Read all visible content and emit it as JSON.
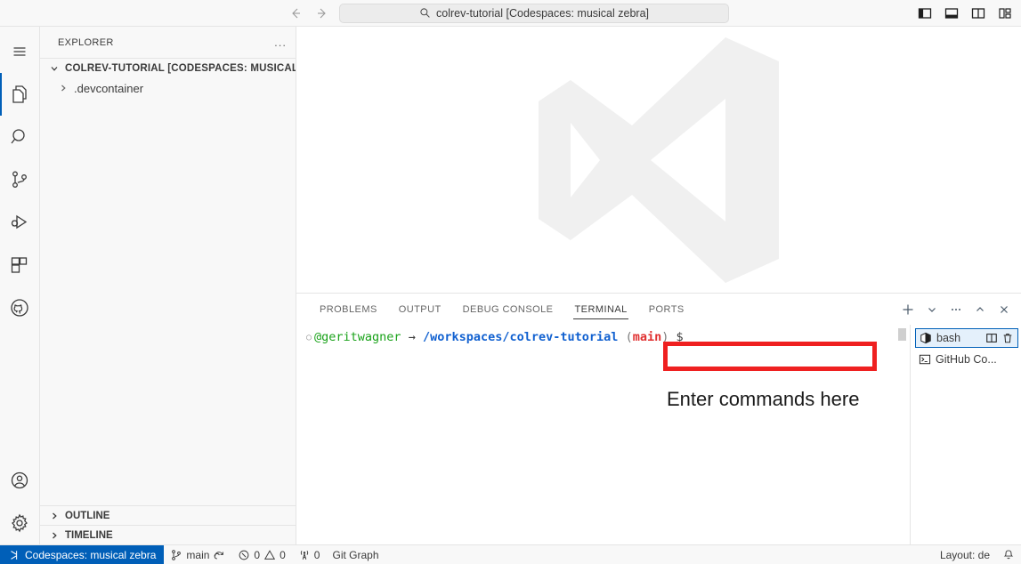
{
  "titlebar": {
    "back_label": "←",
    "forward_label": "→",
    "command_center_text": "colrev-tutorial [Codespaces: musical zebra]",
    "search_icon": "search-icon",
    "layout_icons": [
      {
        "name": "toggle-primary-sidebar-icon"
      },
      {
        "name": "toggle-panel-icon"
      },
      {
        "name": "toggle-secondary-sidebar-icon"
      },
      {
        "name": "customize-layout-icon"
      }
    ]
  },
  "activitybar": {
    "items": [
      {
        "name": "menu-icon",
        "label": "Menu",
        "active": false
      },
      {
        "name": "explorer-icon",
        "label": "Explorer",
        "active": true
      },
      {
        "name": "search-icon",
        "label": "Search",
        "active": false
      },
      {
        "name": "source-control-icon",
        "label": "Source Control",
        "active": false
      },
      {
        "name": "run-and-debug-icon",
        "label": "Run and Debug",
        "active": false
      },
      {
        "name": "extensions-icon",
        "label": "Extensions",
        "active": false
      },
      {
        "name": "github-icon",
        "label": "GitHub",
        "active": false
      }
    ],
    "bottom_items": [
      {
        "name": "accounts-icon",
        "label": "Accounts"
      },
      {
        "name": "settings-gear-icon",
        "label": "Manage"
      }
    ]
  },
  "sidebar": {
    "title": "EXPLORER",
    "more_actions": "...",
    "root_folder": "COLREV-TUTORIAL [CODESPACES: MUSICAL ZEB...",
    "children": [
      {
        "label": ".devcontainer",
        "expanded": false
      }
    ],
    "sections": [
      {
        "label": "OUTLINE",
        "expanded": false
      },
      {
        "label": "TIMELINE",
        "expanded": false
      }
    ]
  },
  "editor": {
    "watermark": "vscode-logo-watermark"
  },
  "panel": {
    "tabs": [
      {
        "label": "PROBLEMS",
        "active": false
      },
      {
        "label": "OUTPUT",
        "active": false
      },
      {
        "label": "DEBUG CONSOLE",
        "active": false
      },
      {
        "label": "TERMINAL",
        "active": true
      },
      {
        "label": "PORTS",
        "active": false
      }
    ],
    "actions": [
      {
        "name": "new-terminal-icon",
        "label": "+"
      },
      {
        "name": "chevron-down-icon",
        "label": "⌄"
      },
      {
        "name": "more-actions-icon",
        "label": "…"
      },
      {
        "name": "collapse-panel-icon",
        "label": "^"
      },
      {
        "name": "close-panel-icon",
        "label": "×"
      }
    ],
    "terminal": {
      "prompt_bullet": "○",
      "user": "@geritwagner",
      "arrow": "→",
      "path": "/workspaces/colrev-tutorial",
      "paren_open": "(",
      "branch": "main",
      "paren_close": ")",
      "dollar": "$",
      "input_value": ""
    },
    "terminal_tabs": [
      {
        "label": "bash",
        "icon": "terminal-cube-icon",
        "active": true,
        "actions": [
          {
            "name": "split-terminal-icon"
          },
          {
            "name": "kill-terminal-icon"
          }
        ]
      },
      {
        "label": "GitHub Co...",
        "icon": "terminal-prompt-icon",
        "active": false,
        "actions": []
      }
    ]
  },
  "annotations": {
    "box": {
      "name": "command-input-highlight"
    },
    "text": "Enter commands here"
  },
  "statusbar": {
    "remote": {
      "label": "Codespaces: musical zebra",
      "icon": "remote-icon"
    },
    "branch": {
      "label": "main",
      "icon": "source-control-icon",
      "sync_icon": "sync-icon"
    },
    "errors": {
      "count": "0",
      "icon": "error-icon"
    },
    "warnings": {
      "count": "0",
      "icon": "warning-icon"
    },
    "ports": {
      "count": "0",
      "icon": "radio-tower-icon"
    },
    "git_graph": "Git Graph",
    "layout": "Layout: de",
    "bell": {
      "icon": "bell-icon"
    }
  },
  "colors": {
    "accent": "#005fb8",
    "annotation_red": "#ef2020",
    "prompt_green": "#19a219",
    "prompt_blue": "#1060d0",
    "branch_red": "#e03030"
  }
}
